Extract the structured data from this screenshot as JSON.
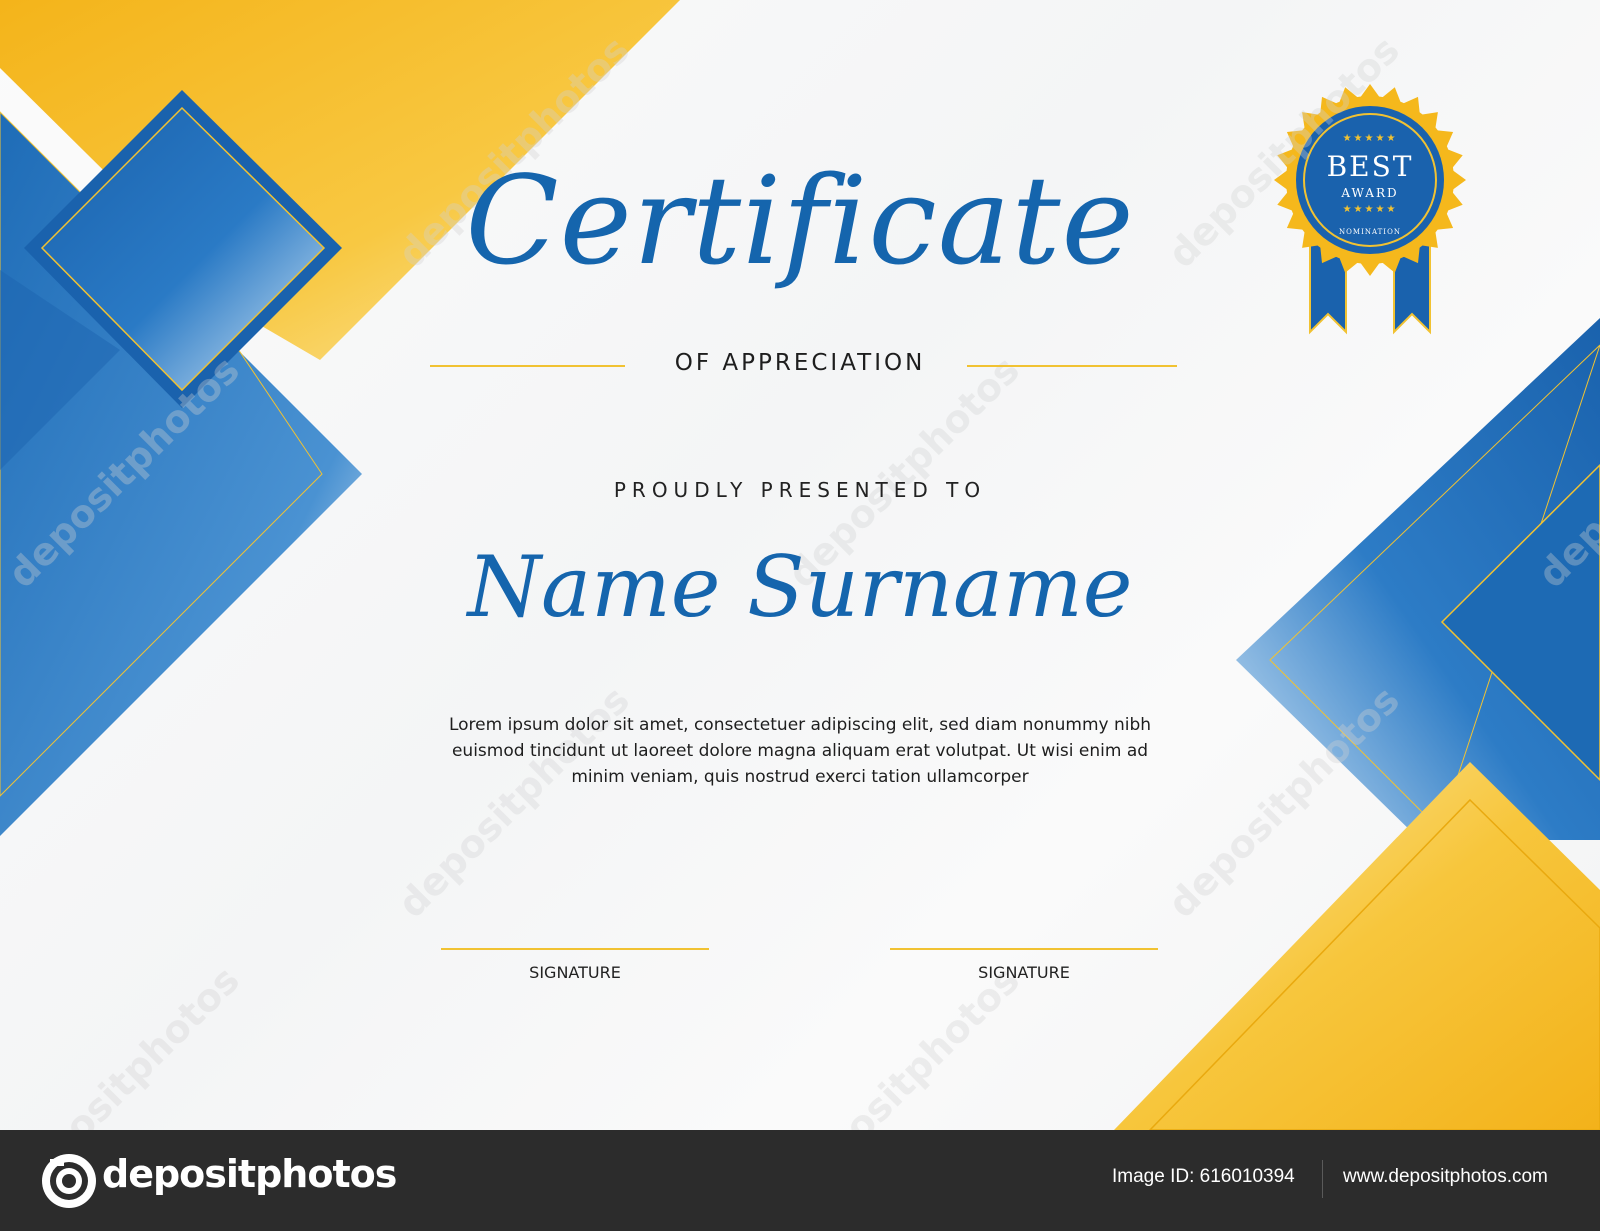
{
  "certificate": {
    "title": "Certificate",
    "subtitle": "OF APPRECIATION",
    "presented_line": "PROUDLY PRESENTED TO",
    "recipient": "Name Surname",
    "body": "Lorem ipsum dolor sit amet, consectetuer adipiscing elit, sed diam nonummy nibh euismod tincidunt ut laoreet dolore magna aliquam erat volutpat. Ut wisi enim ad minim veniam, quis nostrud exerci tation ullamcorper",
    "signatures": [
      {
        "label": "SIGNATURE"
      },
      {
        "label": "SIGNATURE"
      }
    ]
  },
  "badge": {
    "line1": "BEST",
    "line2": "AWARD",
    "line3": "NOMINATION",
    "stars": "★★★★★"
  },
  "watermark": {
    "text": "depositphotos"
  },
  "footer": {
    "logo_text": "depositphotos",
    "image_id": "Image ID: 616010394",
    "website": "www.depositphotos.com"
  },
  "colors": {
    "blue": "#1565ad",
    "gold": "#f5b81c",
    "footer_bg": "#2c2c2c"
  }
}
